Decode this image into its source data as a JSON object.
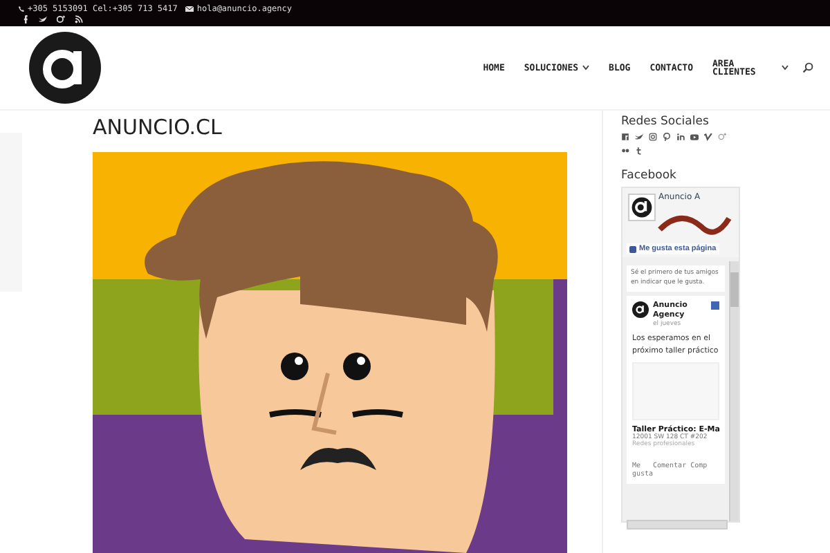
{
  "top_bar": {
    "phone": "+305 5153091 Cel:+305 713 5417",
    "email": "hola@anuncio.agency"
  },
  "nav": {
    "items": [
      {
        "label": "HOME",
        "has_submenu": false
      },
      {
        "label": "SOLUCIONES",
        "has_submenu": true
      },
      {
        "label": "BLOG",
        "has_submenu": false
      },
      {
        "label": "CONTACTO",
        "has_submenu": false
      },
      {
        "label": "AREA CLIENTES",
        "has_submenu": true
      }
    ]
  },
  "page": {
    "title": "ANUNCIO.CL"
  },
  "sidebar": {
    "social_heading": "Redes Sociales",
    "facebook_heading": "Facebook",
    "facebook_widget": {
      "page_name": "Anuncio A",
      "like_button": "Me gusta esta página",
      "friends_note": "Sé el primero de tus amigos en indicar que le gusta.",
      "post": {
        "author": "Anuncio Agency",
        "time": "el jueves",
        "text": "Los esperamos en el próximo taller práctico",
        "link_title": "Taller Práctico: E-Ma",
        "link_address": "12001 SW 128 CT #202",
        "link_caption": "Redes profesionales",
        "actions": [
          "Me gusta",
          "Comentar",
          "Comp"
        ]
      }
    }
  }
}
